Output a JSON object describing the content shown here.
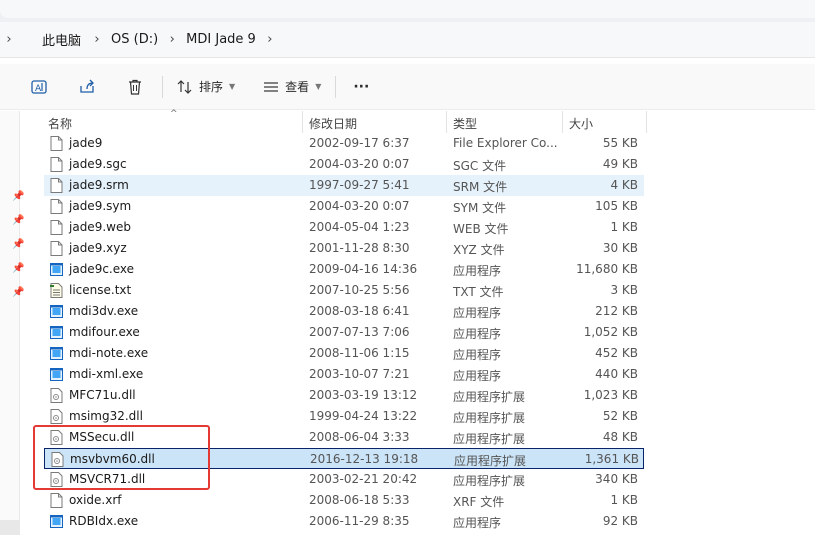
{
  "breadcrumb": {
    "items": [
      "此电脑",
      "OS (D:)",
      "MDI Jade 9"
    ]
  },
  "toolbar": {
    "sort_label": "排序",
    "view_label": "查看",
    "more_label": "···"
  },
  "columns": {
    "name": "名称",
    "date": "修改日期",
    "type": "类型",
    "size": "大小"
  },
  "files": [
    {
      "name": "jade9",
      "date": "2002-09-17 6:37",
      "type": "File Explorer Co...",
      "size": "55 KB",
      "icon": "file-icon"
    },
    {
      "name": "jade9.sgc",
      "date": "2004-03-20 0:07",
      "type": "SGC 文件",
      "size": "49 KB",
      "icon": "file-icon"
    },
    {
      "name": "jade9.srm",
      "date": "1997-09-27 5:41",
      "type": "SRM 文件",
      "size": "4 KB",
      "icon": "file-icon"
    },
    {
      "name": "jade9.sym",
      "date": "2004-03-20 0:07",
      "type": "SYM 文件",
      "size": "105 KB",
      "icon": "file-icon"
    },
    {
      "name": "jade9.web",
      "date": "2004-05-04 1:23",
      "type": "WEB 文件",
      "size": "1 KB",
      "icon": "file-icon"
    },
    {
      "name": "jade9.xyz",
      "date": "2001-11-28 8:30",
      "type": "XYZ 文件",
      "size": "30 KB",
      "icon": "file-icon"
    },
    {
      "name": "jade9c.exe",
      "date": "2009-04-16 14:36",
      "type": "应用程序",
      "size": "11,680 KB",
      "icon": "exe-icon"
    },
    {
      "name": "license.txt",
      "date": "2007-10-25 5:56",
      "type": "TXT 文件",
      "size": "3 KB",
      "icon": "text-file-icon"
    },
    {
      "name": "mdi3dv.exe",
      "date": "2008-03-18 6:41",
      "type": "应用程序",
      "size": "212 KB",
      "icon": "exe-icon"
    },
    {
      "name": "mdifour.exe",
      "date": "2007-07-13 7:06",
      "type": "应用程序",
      "size": "1,052 KB",
      "icon": "exe-icon"
    },
    {
      "name": "mdi-note.exe",
      "date": "2008-11-06 1:15",
      "type": "应用程序",
      "size": "452 KB",
      "icon": "exe-icon"
    },
    {
      "name": "mdi-xml.exe",
      "date": "2003-10-07 7:21",
      "type": "应用程序",
      "size": "440 KB",
      "icon": "exe-icon"
    },
    {
      "name": "MFC71u.dll",
      "date": "2003-03-19 13:12",
      "type": "应用程序扩展",
      "size": "1,023 KB",
      "icon": "dll-icon"
    },
    {
      "name": "msimg32.dll",
      "date": "1999-04-24 13:22",
      "type": "应用程序扩展",
      "size": "52 KB",
      "icon": "dll-icon"
    },
    {
      "name": "MSSecu.dll",
      "date": "2008-06-04 3:33",
      "type": "应用程序扩展",
      "size": "48 KB",
      "icon": "dll-icon"
    },
    {
      "name": "msvbvm60.dll",
      "date": "2016-12-13 19:18",
      "type": "应用程序扩展",
      "size": "1,361 KB",
      "icon": "dll-icon"
    },
    {
      "name": "MSVCR71.dll",
      "date": "2003-02-21 20:42",
      "type": "应用程序扩展",
      "size": "340 KB",
      "icon": "dll-icon"
    },
    {
      "name": "oxide.xrf",
      "date": "2008-06-18 5:33",
      "type": "XRF 文件",
      "size": "1 KB",
      "icon": "file-icon"
    },
    {
      "name": "RDBIdx.exe",
      "date": "2006-11-29 8:35",
      "type": "应用程序",
      "size": "92 KB",
      "icon": "exe-icon"
    }
  ],
  "state": {
    "hover_row": 2,
    "selected_row": 15
  },
  "colors": {
    "hover": "#e5f1fb",
    "selected": "#cce4f7",
    "highlight_box": "#e53935"
  }
}
